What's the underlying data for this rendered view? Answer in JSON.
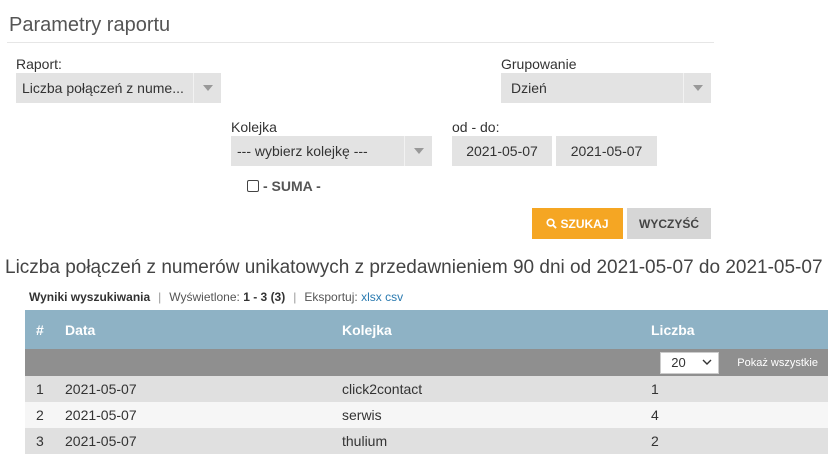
{
  "panel": {
    "title": "Parametry raportu"
  },
  "form": {
    "report_label": "Raport:",
    "report_value": "Liczba połączeń z nume...",
    "grouping_label": "Grupowanie",
    "grouping_value": "Dzień",
    "queue_label": "Kolejka",
    "queue_value": "--- wybierz kolejkę ---",
    "date_range_label": "od - do:",
    "date_from": "2021-05-07",
    "date_to": "2021-05-07",
    "sum_label": "- SUMA -",
    "sum_checked": false,
    "search_button": "SZUKAJ",
    "clear_button": "WYCZYŚĆ"
  },
  "report": {
    "title": "Liczba połączeń z numerów unikatowych z przedawnieniem 90 dni od 2021-05-07 do 2021-05-07"
  },
  "results": {
    "label": "Wyniki wyszukiwania",
    "shown_label": "Wyświetlone:",
    "shown_value": "1 - 3 (3)",
    "export_label": "Eksportuj:",
    "export_xlsx": "xlsx",
    "export_csv": "csv"
  },
  "table": {
    "columns": [
      "#",
      "Data",
      "Kolejka",
      "Liczba"
    ],
    "page_size": "20",
    "show_all": "Pokaż wszystkie",
    "rows": [
      [
        "1",
        "2021-05-07",
        "click2contact",
        "1"
      ],
      [
        "2",
        "2021-05-07",
        "serwis",
        "4"
      ],
      [
        "3",
        "2021-05-07",
        "thulium",
        "2"
      ]
    ]
  },
  "colors": {
    "accent": "#f5a623",
    "table_header": "#8eb2c5",
    "pager_row": "#8f8f8f"
  }
}
